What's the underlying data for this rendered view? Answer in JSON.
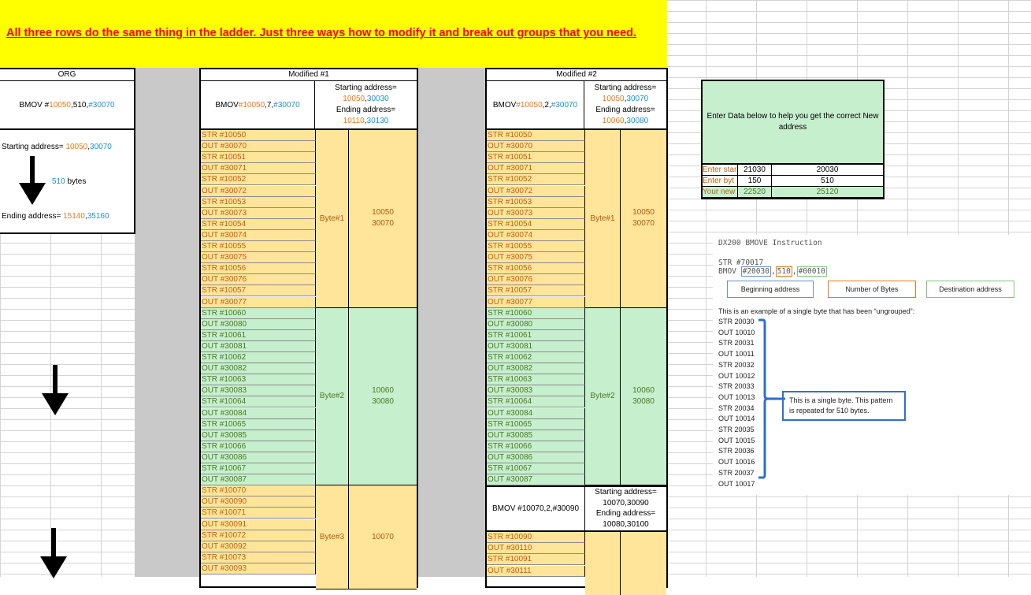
{
  "banner": "All three rows do the same thing in the ladder. Just three ways how to modify it and break out groups that you need.",
  "org": {
    "header": "ORG",
    "instr_pre": "BMOV #",
    "instr_a": "10050",
    "instr_b": ",510,",
    "instr_c": "#30070",
    "start_label": "Starting address= ",
    "start_a": "10050",
    "start_sep": ",",
    "start_b": "30070",
    "bytes_num": "510",
    "bytes_word": " bytes",
    "end_label": "Ending address= ",
    "end_a": "15140",
    "end_sep": ",",
    "end_b": "35160"
  },
  "mod1": {
    "header": "Modified #1",
    "instr_pre": "BMOV ",
    "instr_a": "#10050",
    "instr_b": ",7,",
    "instr_c": "#30070",
    "start_label": "Starting address=",
    "start_a": "10050",
    "start_b": "30030",
    "end_label": "Ending address=",
    "end_a": "10110",
    "end_b": "30130",
    "rows": [
      "STR #10050",
      "OUT #30070",
      "STR #10051",
      "OUT #30071",
      "STR #10052",
      "OUT #30072",
      "STR #10053",
      "OUT #30073",
      "STR #10054",
      "OUT #30074",
      "STR #10055",
      "OUT #30075",
      "STR #10056",
      "OUT #30076",
      "STR #10057",
      "OUT #30077",
      "STR #10060",
      "OUT #30080",
      "STR #10061",
      "OUT #30081",
      "STR #10062",
      "OUT #30082",
      "STR #10063",
      "OUT #30083",
      "STR #10064",
      "OUT #30084",
      "STR #10065",
      "OUT #30085",
      "STR #10066",
      "OUT #30086",
      "STR #10067",
      "OUT #30087",
      "STR #10070",
      "OUT #30090",
      "STR #10071",
      "OUT #30091",
      "STR #10072",
      "OUT #30092",
      "STR #10073",
      "OUT #30093"
    ],
    "bytes": [
      {
        "label": "Byte#1",
        "a": "10050",
        "b": "30070"
      },
      {
        "label": "Byte#2",
        "a": "10060",
        "b": "30080"
      },
      {
        "label": "Byte#3",
        "a": "10070",
        "b": ""
      }
    ]
  },
  "mod2": {
    "header": "Modified #2",
    "instr_pre": "BMOV ",
    "instr_a": "#10050",
    "instr_b": ",2,",
    "instr_c": "#30070",
    "start_label": "Starting address=",
    "start_a": "10050",
    "start_b": "30070",
    "end_label": "Ending address=",
    "end_a": "10060",
    "end_b": "30080",
    "rows": [
      "STR #10050",
      "OUT #30070",
      "STR #10051",
      "OUT #30071",
      "STR #10052",
      "OUT #30072",
      "STR #10053",
      "OUT #30073",
      "STR #10054",
      "OUT #30074",
      "STR #10055",
      "OUT #30075",
      "STR #10056",
      "OUT #30076",
      "STR #10057",
      "OUT #30077",
      "STR #10060",
      "OUT #30080",
      "STR #10061",
      "OUT #30081",
      "STR #10062",
      "OUT #30082",
      "STR #10063",
      "OUT #30083",
      "STR #10064",
      "OUT #30084",
      "STR #10065",
      "OUT #30085",
      "STR #10066",
      "OUT #30086",
      "STR #10067",
      "OUT #30087"
    ],
    "bytes": [
      {
        "label": "Byte#1",
        "a": "10050",
        "b": "30070"
      },
      {
        "label": "Byte#2",
        "a": "10060",
        "b": "30080"
      }
    ],
    "second_instr": "BMOV #10070,2,#30090",
    "second_start_label": "Starting address=",
    "second_start": "10070,30090",
    "second_end_label": "Ending address=",
    "second_end": "10080,30100",
    "rows2": [
      "STR #10090",
      "OUT #30110",
      "STR #10091",
      "OUT #30111"
    ]
  },
  "calc": {
    "title": "Enter Data below to help you get the correct New address",
    "rows": [
      {
        "label": "Enter star",
        "a": "21030",
        "b": "20030"
      },
      {
        "label": "Enter byt",
        "a": "150",
        "b": "510"
      },
      {
        "label": "Your new",
        "a": "22520",
        "b": "25120"
      }
    ]
  },
  "dx": {
    "title": "DX200 BMOVE Instruction",
    "line1": "STR #70017",
    "line2_pre": "BMOV ",
    "line2_a": "#20030",
    "line2_b": "510",
    "line2_c": "#00010",
    "leg1": "Beginning address",
    "leg2": "Number of Bytes",
    "leg3": "Destination address",
    "example": "This is an example of a single byte that has been “ungrouped”:",
    "lines": [
      "STR 20030",
      "OUT 10010",
      "STR 20031",
      "OUT 10011",
      "STR 20032",
      "OUT 10012",
      "STR 20033",
      "OUT 10013",
      "STR 20034",
      "OUT 10014",
      "STR 20035",
      "OUT 10015",
      "STR 20036",
      "OUT 10016",
      "STR 20037",
      "OUT 10017"
    ],
    "callout": "This is a single byte. This pattern is repeated for 510 bytes.",
    "colors": {
      "orange": "#e07a1f",
      "blue": "#1f8fd0",
      "bracket": "#2e6fd0"
    }
  }
}
